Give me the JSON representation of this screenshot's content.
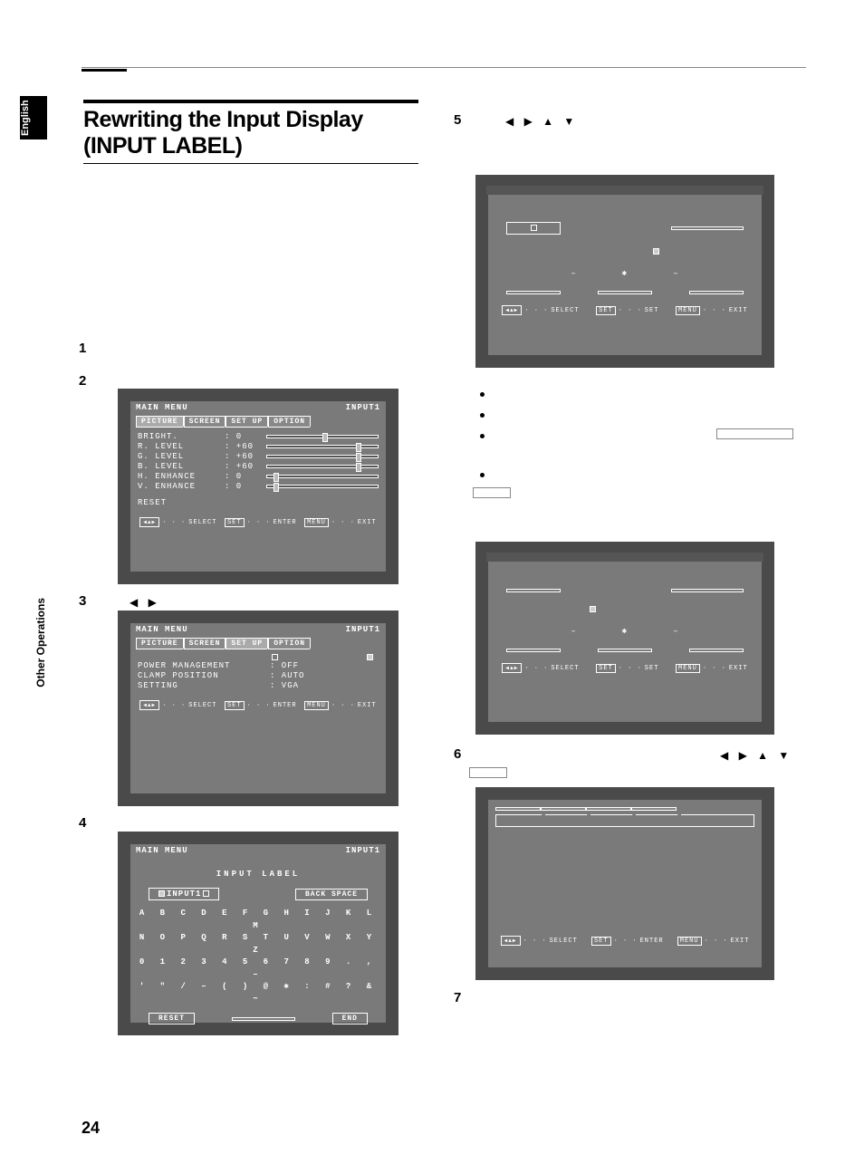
{
  "page_number": "24",
  "tab_english": "English",
  "tab_other_ops": "Other Operations",
  "title_line1": "Rewriting the Input Display",
  "title_line2": "(INPUT LABEL)",
  "steps": {
    "s1": "1",
    "s2": "2",
    "s3": "3",
    "s4": "4",
    "s5": "5",
    "s6": "6",
    "s7": "7"
  },
  "arrows": {
    "lr": "◀ ▶",
    "all": "◀ ▶ ▲ ▼"
  },
  "osd": {
    "main_menu": "MAIN  MENU",
    "input1": "INPUT1",
    "tabs": {
      "picture": "PICTURE",
      "screen": "SCREEN",
      "setup": "SET UP",
      "option": "OPTION"
    },
    "picture_rows": [
      {
        "label": "BRIGHT.",
        "val": ":   0",
        "knob": 50
      },
      {
        "label": "R. LEVEL",
        "val": ": +60",
        "knob": 80
      },
      {
        "label": "G. LEVEL",
        "val": ": +60",
        "knob": 80
      },
      {
        "label": "B. LEVEL",
        "val": ": +60",
        "knob": 80
      },
      {
        "label": "H. ENHANCE",
        "val": ":   0",
        "knob": 8
      },
      {
        "label": "V. ENHANCE",
        "val": ":   0",
        "knob": 8
      }
    ],
    "reset": "RESET",
    "setup_rows": [
      {
        "label": "POWER  MANAGEMENT",
        "val": ": OFF"
      },
      {
        "label": "CLAMP  POSITION",
        "val": ": AUTO"
      },
      {
        "label": "SETTING",
        "val": ": VGA"
      }
    ],
    "input_label_title": "INPUT  LABEL",
    "input_label_field": "INPUT1",
    "back_space": "BACK SPACE",
    "end": "END",
    "char_rows": [
      "A B C D E F G H I J K L M",
      "N O P Q R S T U V W X Y Z",
      "0 1 2 3 4 5 6 7 8 9 . , –",
      "' \" / – ( ) @ ✱ : # ? & ~"
    ],
    "center_marks": {
      "dash": "–",
      "star": "✱"
    },
    "foot": {
      "select": "SELECT",
      "enter": "ENTER",
      "set_cap": "SET",
      "set": "SET",
      "menu": "MENU",
      "exit": "EXIT",
      "dots": "· · ·"
    }
  }
}
